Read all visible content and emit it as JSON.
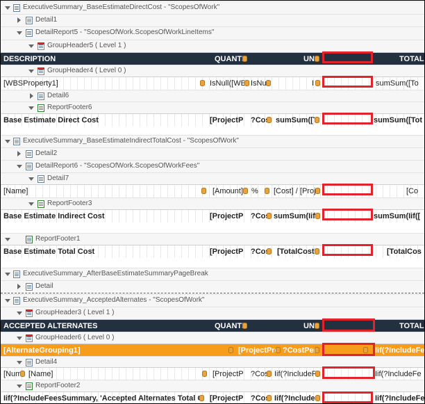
{
  "bands": {
    "b1": "ExecutiveSummary_BaseEstimateDirectCost - \"ScopesOfWork\"",
    "b2": "Detail1",
    "b3": "DetailReport5 - \"ScopesOfWork.ScopesOfWorkLineItems\"",
    "b4": "GroupHeader5 ( Level 1 )",
    "b5": "GroupHeader4 ( Level 0 )",
    "b6": "Detail6",
    "b7": "ReportFooter6",
    "b8": "ExecutiveSummary_BaseEstimateIndirectTotalCost - \"ScopesOfWork\"",
    "b9": "Detail2",
    "b10": "DetailReport6 - \"ScopesOfWork.ScopesOfWorkFees\"",
    "b11": "Detail7",
    "b12": "ReportFooter3",
    "b13": "ReportFooter1",
    "b14": "ExecutiveSummary_AfterBaseEstimateSummaryPageBreak",
    "b15": "Detail",
    "b16": "ExecutiveSummary_AcceptedAlternates - \"ScopesOfWork\"",
    "b17": "GroupHeader3 ( Level 1 )",
    "b18": "GroupHeader6 ( Level 0 )",
    "b19": "Detail4",
    "b20": "ReportFooter2"
  },
  "rows": {
    "r1": {
      "c1": "DESCRIPTION",
      "c2": "QUANTI",
      "c3": "UNI",
      "c4": "TOTAL"
    },
    "r2": {
      "c1": "[WBSProperty1]",
      "c2": "IsNull([WE",
      "c3": "IsNu",
      "c4": "I",
      "c5": "sumSum([To"
    },
    "r3": {
      "c1": "Base Estimate Direct Cost",
      "c2": "[ProjectP",
      "c3": "?Cos",
      "c4": "sumSum([T",
      "c5": "sumSum([Tot"
    },
    "r4": {
      "c1": "[Name]",
      "c2": "[Amount]",
      "c3": "%",
      "c4": "[Cost] / [Proj",
      "c5": "[Co"
    },
    "r5": {
      "c1": "Base Estimate Indirect Cost",
      "c2": "[ProjectP",
      "c3": "?Cos",
      "c4": "sumSum(Iif(",
      "c5": "sumSum(Iif(["
    },
    "r6": {
      "c1": "Base Estimate Total Cost",
      "c2": "[ProjectP",
      "c3": "?Cos",
      "c4": "[TotalCost]",
      "c5": "[TotalCos"
    },
    "r7": {
      "c1": "ACCEPTED ALTERNATES",
      "c2": "QUANTI",
      "c3": "UNI",
      "c4": "TOTAL"
    },
    "r8": {
      "c1": "[AlternateGrouping1]",
      "c2": "[ProjectPro",
      "c3": "?CostPer",
      "c4": "Iif(?IncludeFe"
    },
    "r9": {
      "c1": "[Num",
      "c2": "[Name]",
      "c3": "[ProjectP",
      "c4": "?Cos",
      "c5": "Iif(?IncludeFe",
      "c6": "Iif(?IncludeFe"
    },
    "r10": {
      "c1": "Iif(?IncludeFeesSummary, 'Accepted Alternates Total Cost'",
      "c2": "[ProjectP",
      "c3": "?Cos",
      "c4": "Iif(?IncludeFe",
      "c5": "Iif(?IncludeFe"
    }
  },
  "icons": {
    "band_icon": "band-icon",
    "group_header_icon": "group-header-icon",
    "footer_icon": "report-footer-icon",
    "field_icon": "database-field-icon"
  },
  "colors": {
    "header_dark": "#233040",
    "group_orange": "#f89c1c",
    "highlight_red": "#e1242b"
  }
}
